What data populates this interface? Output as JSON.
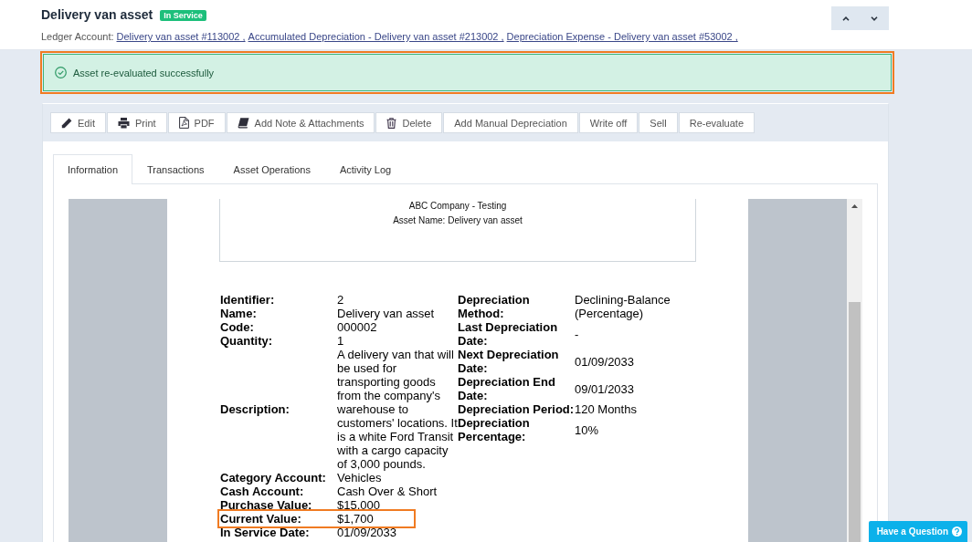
{
  "header": {
    "title": "Delivery van asset",
    "status": "In Service",
    "ledger_label": "Ledger Account:",
    "ledger_links": [
      "Delivery van asset #113002 ,",
      "Accumulated Depreciation - Delivery van asset #213002 ,",
      "Depreciation Expense - Delivery van asset #53002 ,"
    ]
  },
  "alert": {
    "message": "Asset re-evaluated successfully",
    "highlighted": true
  },
  "toolbar": {
    "buttons": [
      {
        "label": "Edit",
        "kind": "edit"
      },
      {
        "label": "Print",
        "kind": "print"
      },
      {
        "label": "PDF",
        "kind": "pdf"
      },
      {
        "label": "Add Note & Attachments",
        "kind": "note"
      },
      {
        "label": "Delete",
        "kind": "delete"
      },
      {
        "label": "Add Manual Depreciation",
        "kind": "text"
      },
      {
        "label": "Write off",
        "kind": "text"
      },
      {
        "label": "Sell",
        "kind": "text"
      },
      {
        "label": "Re-evaluate",
        "kind": "text"
      }
    ]
  },
  "tabs": [
    {
      "label": "Information",
      "selected": true
    },
    {
      "label": "Transactions",
      "selected": false
    },
    {
      "label": "Asset Operations",
      "selected": false
    },
    {
      "label": "Activity Log",
      "selected": false
    }
  ],
  "document": {
    "company": "ABC Company - Testing",
    "asset_name": "Asset Name: Delivery van asset",
    "left_fields": [
      {
        "label": "Identifier:",
        "value": "2",
        "highlighted": false
      },
      {
        "label": "Name:",
        "value": "Delivery van asset",
        "highlighted": false
      },
      {
        "label": "Code:",
        "value": "000002",
        "highlighted": false
      },
      {
        "label": "Quantity:",
        "value": "1",
        "highlighted": false
      },
      {
        "label": "Description:",
        "value": "A delivery van that will be used for transporting goods from the company's warehouse to customers' locations. It is a white Ford Transit with a cargo capacity of 3,000 pounds.",
        "highlighted": false
      },
      {
        "label": "Category Account:",
        "value": "Vehicles",
        "highlighted": false
      },
      {
        "label": "Cash Account:",
        "value": "Cash Over & Short",
        "highlighted": false
      },
      {
        "label": "Purchase Value:",
        "value": "$15,000",
        "highlighted": false
      },
      {
        "label": "Current Value:",
        "value": "$1,700",
        "highlighted": true
      },
      {
        "label": "In Service Date:",
        "value": "01/09/2033",
        "highlighted": false
      }
    ],
    "right_fields": [
      {
        "label": "Depreciation Method:",
        "value": "Declining-Balance (Percentage)"
      },
      {
        "label": "Last Depreciation Date:",
        "value": "-"
      },
      {
        "label": "Next Depreciation Date:",
        "value": "01/09/2033"
      },
      {
        "label": "Depreciation End Date:",
        "value": "09/01/2033"
      },
      {
        "label": "Depreciation Period:",
        "value": "120 Months"
      },
      {
        "label": "Depreciation Percentage:",
        "value": "10%"
      }
    ]
  },
  "help_button": {
    "label": "Have a Question"
  }
}
